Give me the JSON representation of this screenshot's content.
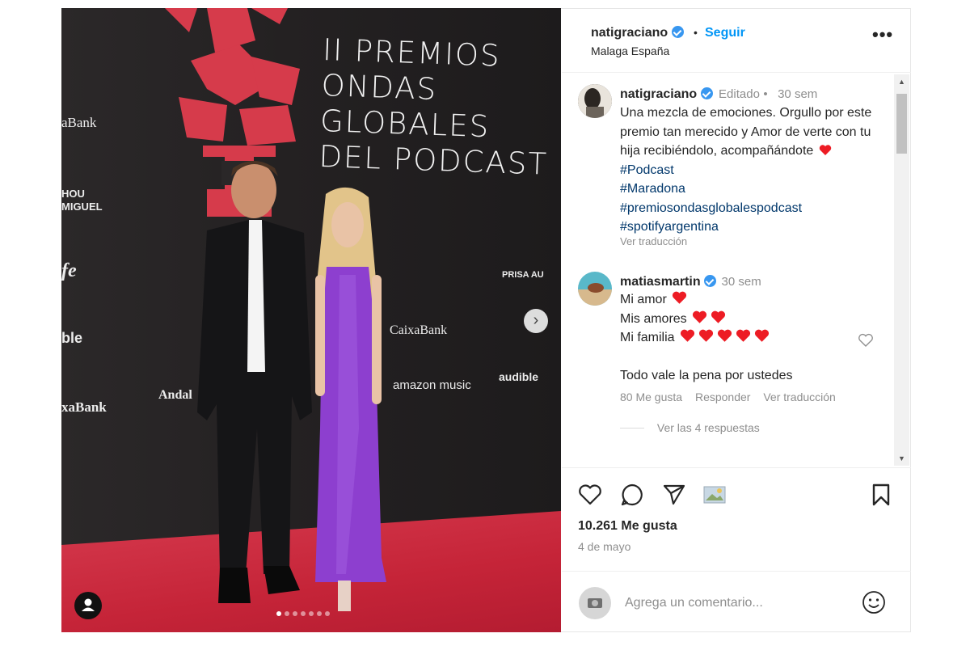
{
  "post": {
    "username": "natigraciano",
    "follow_label": "Seguir",
    "separator": "•",
    "location": "Malaga España",
    "more_label": "•••"
  },
  "photo": {
    "title_lines": [
      "II PREMIOS",
      "ONDAS",
      "GLOBALES",
      "DEL PODCAST"
    ],
    "sponsors": {
      "caixabank_1": "aBank",
      "hou_1": "HOU",
      "hou_2": "MIGUEL",
      "cafe": "fe",
      "audible_left": "ble",
      "caixabank_2": "xaBank",
      "caixabank_center": "CaixaBank",
      "amazon": "amazon music",
      "audible_right": "audible",
      "prisa": "PRISA AU",
      "andalucia": "Andal"
    },
    "next_arrow": "›",
    "carousel_dots": 7,
    "carousel_active": 0
  },
  "caption": {
    "username": "natigraciano",
    "edited": "Editado",
    "time": "30 sem",
    "text_parts": [
      "Una mezcla de emociones. Orgullo por este premio tan merecido y Amor de verte con tu hija recibiéndolo, acompañándote"
    ],
    "hashtags": [
      "#Podcast",
      "#Maradona",
      "#premiosondasglobalespodcast",
      "#spotifyargentina"
    ],
    "translate": "Ver traducción"
  },
  "comment": {
    "username": "matiasmartin",
    "time": "30 sem",
    "lines": [
      "Mi amor",
      "Mis amores",
      "Mi familia"
    ],
    "hearts": [
      1,
      2,
      5
    ],
    "last_line": "Todo vale la pena por ustedes",
    "likes": "80 Me gusta",
    "reply": "Responder",
    "translate": "Ver traducción",
    "view_replies": "Ver las 4 respuestas"
  },
  "actions": {
    "likes": "10.261 Me gusta",
    "date": "4 de mayo"
  },
  "add_comment": {
    "placeholder": "Agrega un comentario..."
  },
  "colors": {
    "accent": "#0095f6",
    "verified": "#3897f0",
    "heart": "#ed1c24",
    "hashtag": "#00376b",
    "carpet": "#c52438"
  }
}
